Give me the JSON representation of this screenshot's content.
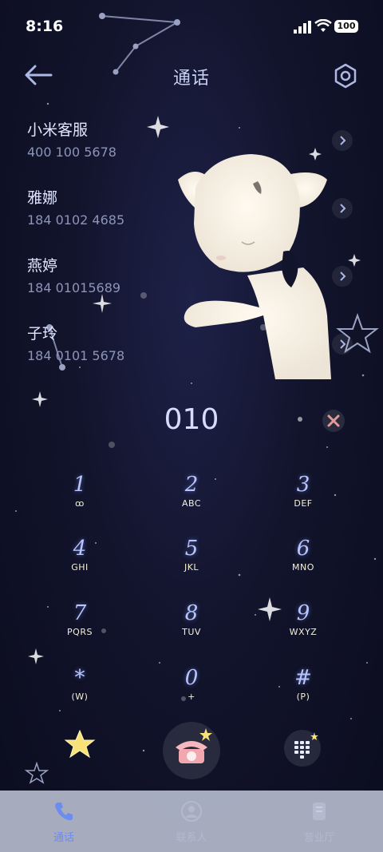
{
  "status": {
    "time": "8:16",
    "battery": "100"
  },
  "header": {
    "title": "通话"
  },
  "contacts": [
    {
      "name": "小米客服",
      "number": "400 100 5678"
    },
    {
      "name": "雅娜",
      "number": "184 0102 4685"
    },
    {
      "name": "燕婷",
      "number": "184 01015689"
    },
    {
      "name": "子玲",
      "number": "184 0101 5678"
    }
  ],
  "dialer": {
    "input": "010",
    "keys": [
      {
        "digit": "1",
        "letters": "ꝏ"
      },
      {
        "digit": "2",
        "letters": "ABC"
      },
      {
        "digit": "3",
        "letters": "DEF"
      },
      {
        "digit": "4",
        "letters": "GHI"
      },
      {
        "digit": "5",
        "letters": "JKL"
      },
      {
        "digit": "6",
        "letters": "MNO"
      },
      {
        "digit": "7",
        "letters": "PQRS"
      },
      {
        "digit": "8",
        "letters": "TUV"
      },
      {
        "digit": "9",
        "letters": "WXYZ"
      },
      {
        "digit": "*",
        "letters": "(W)"
      },
      {
        "digit": "0",
        "letters": "+"
      },
      {
        "digit": "#",
        "letters": "(P)"
      }
    ]
  },
  "nav": [
    {
      "label": "通话",
      "icon": "phone-icon"
    },
    {
      "label": "联系人",
      "icon": "person-icon"
    },
    {
      "label": "营业厅",
      "icon": "store-icon"
    }
  ],
  "colors": {
    "accent": "#7a97ff",
    "navActive": "#6c8cf0",
    "navInactive": "#b4b9cc"
  }
}
